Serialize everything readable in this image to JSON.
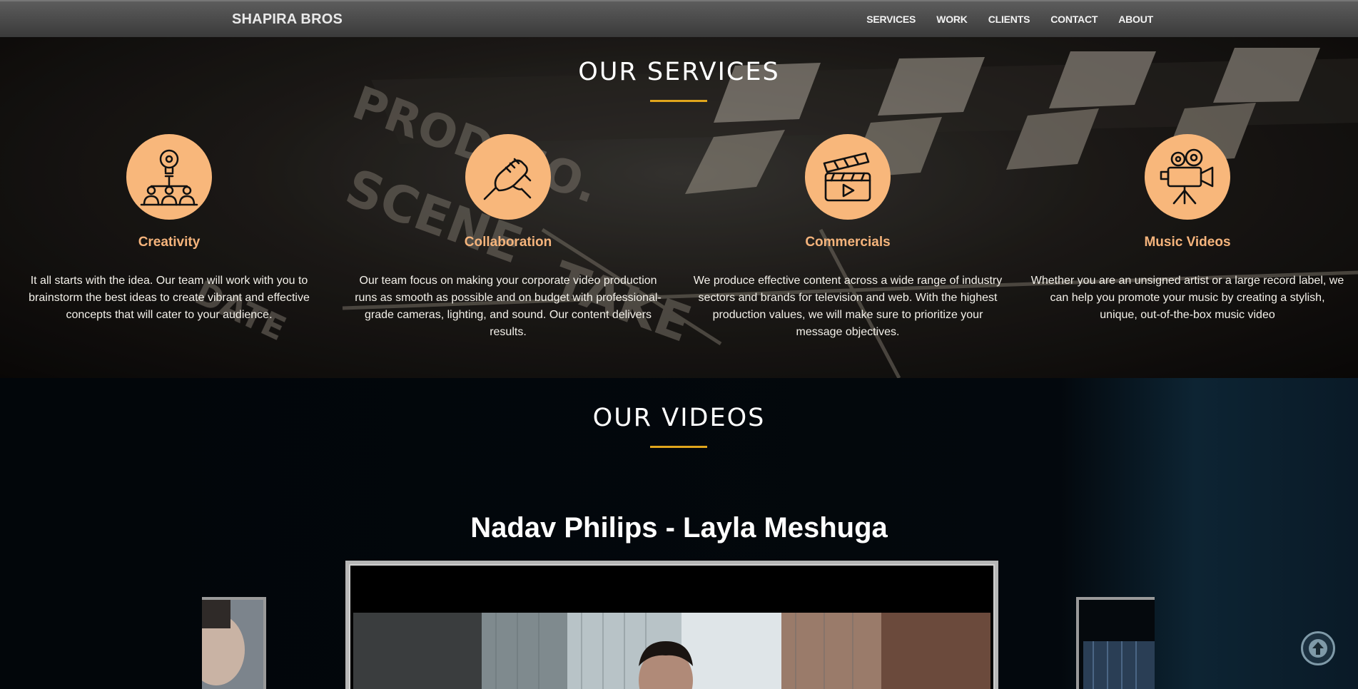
{
  "nav": {
    "brand": "SHAPIRA BROS",
    "links": [
      "SERVICES",
      "WORK",
      "CLIENTS",
      "CONTACT",
      "ABOUT"
    ]
  },
  "services": {
    "title": "OUR SERVICES",
    "items": [
      {
        "name": "Creativity",
        "icon": "idea-team-icon",
        "description": "It all starts with the idea. Our team will work with you to brainstorm the best ideas to create vibrant and effective concepts that will cater to your audience."
      },
      {
        "name": "Collaboration",
        "icon": "handshake-icon",
        "description": "Our team focus on making your corporate video production runs as smooth as possible and on budget with professional-grade cameras, lighting, and sound. Our content delivers results."
      },
      {
        "name": "Commercials",
        "icon": "clapperboard-icon",
        "description": "We produce effective content across a wide range of industry sectors and brands for television and web. With the highest production values, we will make sure to prioritize your message objectives."
      },
      {
        "name": "Music Videos",
        "icon": "video-camera-icon",
        "description": "Whether you are an unsigned artist or a large record label, we can help you promote your music by creating a stylish, unique, out-of-the-box music video"
      }
    ]
  },
  "videos": {
    "title": "OUR VIDEOS",
    "current_title": "Nadav Philips - Layla Meshuga"
  },
  "colors": {
    "accent": "#e0a51c",
    "icon_circle": "#f8b77b",
    "service_name": "#f5b47c"
  },
  "back_to_top_icon": "arrow-up-circle-icon"
}
